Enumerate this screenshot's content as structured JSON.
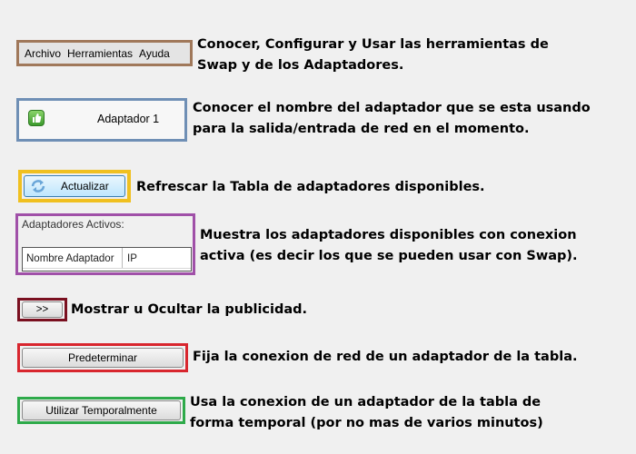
{
  "menu": {
    "items": [
      "Archivo",
      "Herramientas",
      "Ayuda"
    ],
    "description": "Conocer, Configurar y Usar las herramientas de Swap y de los Adaptadores."
  },
  "adapter": {
    "name": "Adaptador 1",
    "description": "Conocer el nombre del adaptador que se esta usando para la salida/entrada de red en el momento."
  },
  "refresh": {
    "label": "Actualizar",
    "description": "Refrescar la Tabla de adaptadores disponibles."
  },
  "active_adapters": {
    "title": "Adaptadores Activos:",
    "columns": [
      "Nombre Adaptador",
      "IP"
    ],
    "description": "Muestra los adaptadores disponibles con conexion activa (es decir los que se pueden usar con Swap)."
  },
  "ads_toggle": {
    "label": ">>",
    "description": "Mostrar u Ocultar la publicidad."
  },
  "default_button": {
    "label": "Predeterminar",
    "description": "Fija la conexion de red de un adaptador de la tabla."
  },
  "temp_button": {
    "label": "Utilizar Temporalmente",
    "description": "Usa la conexion de un adaptador de la tabla de forma temporal (por no mas de varios minutos)"
  },
  "colors": {
    "menu_border": "#a0785a",
    "adapter_border": "#6f8fb5",
    "refresh_border": "#f0c020",
    "table_border": "#a050a8",
    "toggle_border": "#7a1020",
    "default_border": "#d8262e",
    "temp_border": "#2eaa4a"
  }
}
